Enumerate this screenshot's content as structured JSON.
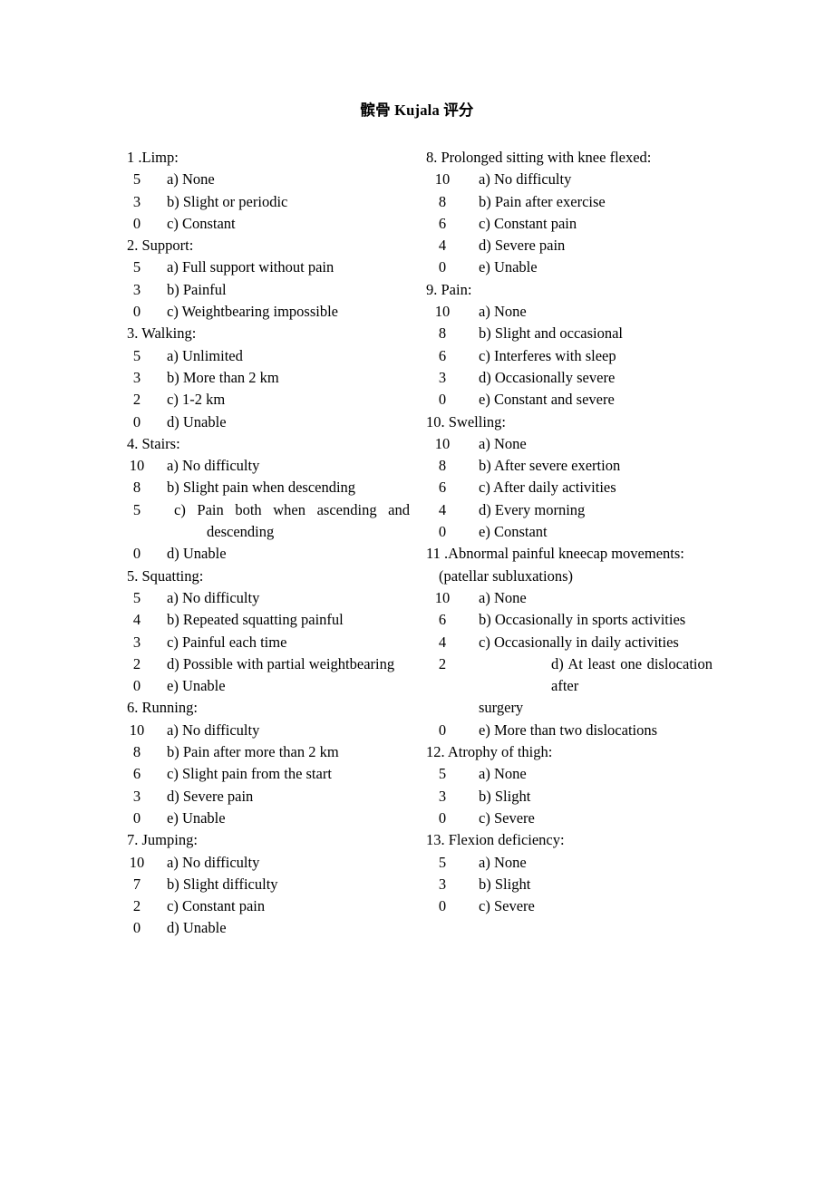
{
  "document": {
    "title": "髌骨 Kujala  评分"
  },
  "left_column": [
    {
      "heading": "1 .Limp:",
      "options": [
        {
          "score": "5",
          "text": "a) None"
        },
        {
          "score": "3",
          "text": "b) Slight or periodic"
        },
        {
          "score": "0",
          "text": "c) Constant"
        }
      ]
    },
    {
      "heading": "2. Support:",
      "options": [
        {
          "score": "5",
          "text": "a) Full support without pain"
        },
        {
          "score": "3",
          "text": "b) Painful"
        },
        {
          "score": "0",
          "text": "c) Weightbearing impossible"
        }
      ]
    },
    {
      "heading": "3. Walking:",
      "options": [
        {
          "score": "5",
          "text": "a) Unlimited"
        },
        {
          "score": "3",
          "text": "b) More than 2 km"
        },
        {
          "score": "2",
          "text": "c) 1-2 km"
        },
        {
          "score": "0",
          "text": "d) Unable"
        }
      ]
    },
    {
      "heading": "4. Stairs:",
      "options": [
        {
          "score": "10",
          "text": "a) No difficulty"
        },
        {
          "score": "8",
          "text": "b) Slight pain when descending"
        },
        {
          "score": "5",
          "text": "c)  Pain  both  when  ascending  and",
          "text_line2": "descending"
        },
        {
          "score": "0",
          "text": "d) Unable"
        }
      ]
    },
    {
      "heading": "5. Squatting:",
      "options": [
        {
          "score": "5",
          "text": "a) No difficulty"
        },
        {
          "score": "4",
          "text": "b) Repeated squatting painful"
        },
        {
          "score": "3",
          "text": "c) Painful each time"
        },
        {
          "score": "2",
          "text": "d) Possible with partial weightbearing"
        },
        {
          "score": "0",
          "text": "e) Unable"
        }
      ]
    },
    {
      "heading": "6. Running:",
      "options": [
        {
          "score": "10",
          "text": "a) No difficulty"
        },
        {
          "score": "8",
          "text": "b) Pain after more than 2 km"
        },
        {
          "score": "6",
          "text": "c) Slight pain from the start"
        },
        {
          "score": "3",
          "text": "d) Severe pain"
        },
        {
          "score": "0",
          "text": "e) Unable"
        }
      ]
    },
    {
      "heading": "7. Jumping:",
      "options": [
        {
          "score": "10",
          "text": "a) No difficulty"
        },
        {
          "score": "7",
          "text": "b) Slight difficulty"
        },
        {
          "score": "2",
          "text": "c) Constant pain"
        },
        {
          "score": "0",
          "text": "d) Unable"
        }
      ]
    }
  ],
  "right_column": [
    {
      "heading": "8. Prolonged sitting with knee flexed:",
      "options": [
        {
          "score": "10",
          "text": "a) No difficulty"
        },
        {
          "score": "8",
          "text": "b) Pain after exercise"
        },
        {
          "score": "6",
          "text": "c) Constant pain"
        },
        {
          "score": "4",
          "text": "d) Severe pain"
        },
        {
          "score": "0",
          "text": "e) Unable"
        }
      ]
    },
    {
      "heading": "9. Pain:",
      "options": [
        {
          "score": "10",
          "text": "a) None"
        },
        {
          "score": "8",
          "text": "b) Slight and occasional"
        },
        {
          "score": "6",
          "text": "c) Interferes with sleep"
        },
        {
          "score": "3",
          "text": "d) Occasionally severe"
        },
        {
          "score": "0",
          "text": "e) Constant and severe"
        }
      ]
    },
    {
      "heading": "10. Swelling:",
      "options": [
        {
          "score": "10",
          "text": "a) None"
        },
        {
          "score": "8",
          "text": "b) After severe exertion"
        },
        {
          "score": "6",
          "text": "c) After daily activities"
        },
        {
          "score": "4",
          "text": "d) Every morning"
        },
        {
          "score": "0",
          "text": "e) Constant"
        }
      ]
    },
    {
      "heading": "11 .Abnormal painful kneecap movements:",
      "subheading": "(patellar subluxations)",
      "options": [
        {
          "score": "10",
          "text": "a) None"
        },
        {
          "score": "6",
          "text": "b) Occasionally in sports activities"
        },
        {
          "score": "4",
          "text": "c) Occasionally in daily activities"
        },
        {
          "score": "2",
          "text": "d)  At  least  one  dislocation  after",
          "text_line2": "surgery"
        },
        {
          "score": "0",
          "text": "e) More than two dislocations"
        }
      ]
    },
    {
      "heading": "12. Atrophy of thigh:",
      "options": [
        {
          "score": "5",
          "text": "a) None"
        },
        {
          "score": "3",
          "text": "b) Slight"
        },
        {
          "score": "0",
          "text": "c) Severe"
        }
      ]
    },
    {
      "heading": "13. Flexion deficiency:",
      "options": [
        {
          "score": "5",
          "text": "a) None"
        },
        {
          "score": "3",
          "text": "b) Slight"
        },
        {
          "score": "0",
          "text": "c) Severe"
        }
      ]
    }
  ]
}
